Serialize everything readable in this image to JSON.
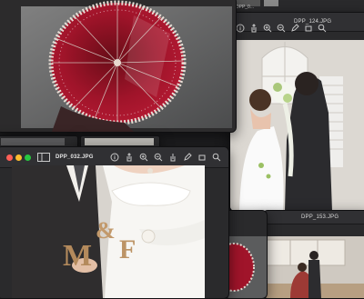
{
  "windows": {
    "top_right": {
      "title": "DPP_124.JPG"
    },
    "top_right_small": {
      "title": "DPP_0..."
    },
    "main": {
      "title": "DPP_032.JPG"
    },
    "bottom_right": {
      "title": "DPP_153.JPG"
    }
  },
  "toolbar_icons": [
    "info-icon",
    "share-icon",
    "zoom-in-icon",
    "zoom-out-icon",
    "markup-icon",
    "rotate-icon",
    "search-icon"
  ],
  "colors": {
    "window_bg": "#2a2a2c",
    "titlebar_bg": "#303033",
    "close_red": "#ff5f57",
    "minimize_yellow": "#febc2e",
    "zoom_green": "#28c840"
  }
}
